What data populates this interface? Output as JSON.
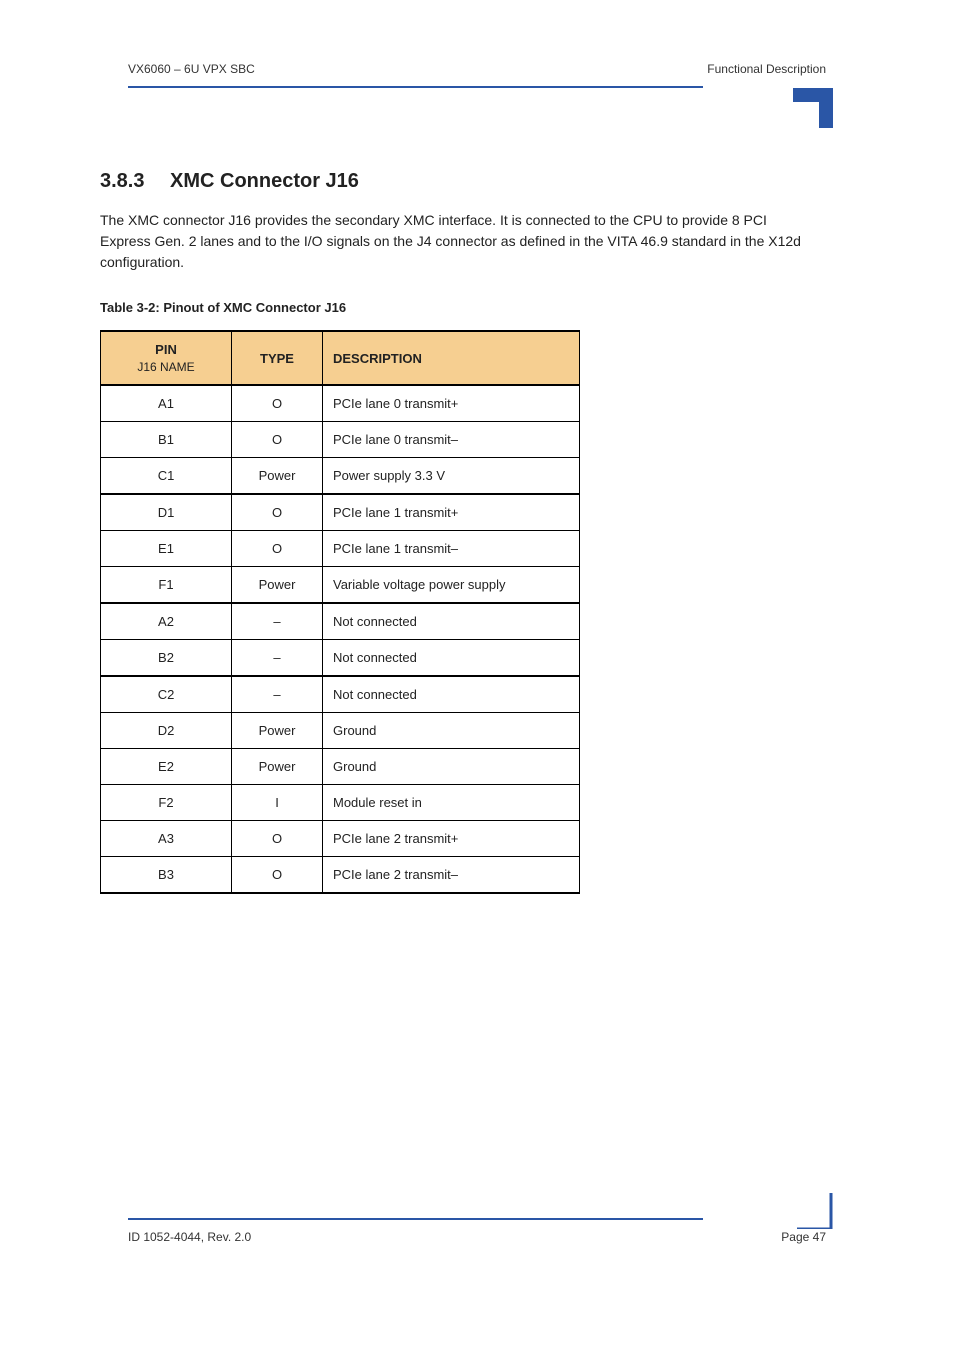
{
  "header": {
    "left": "VX6060 – 6U VPX SBC",
    "right": "Functional Description"
  },
  "section": {
    "number": "3.8.3",
    "title": "XMC Connector J16"
  },
  "paragraph": "The XMC connector J16 provides the secondary XMC interface. It is connected to the CPU to provide 8 PCI Express Gen. 2 lanes and to the I/O signals on the J4 connector as defined in the VITA 46.9 standard in the X12d configuration.",
  "table": {
    "caption": "Table 3-2:  Pinout of XMC Connector J16",
    "columns": [
      {
        "label": "PIN",
        "sub": "J16 NAME"
      },
      {
        "label": "TYPE",
        "sub": ""
      },
      {
        "label": "DESCRIPTION",
        "sub": ""
      }
    ],
    "rows": [
      {
        "pin": "A1",
        "type": "O",
        "desc": "PCIe lane 0 transmit+",
        "group_start": true
      },
      {
        "pin": "B1",
        "type": "O",
        "desc": "PCIe lane 0 transmit–"
      },
      {
        "pin": "C1",
        "type": "Power",
        "desc": "Power supply 3.3 V"
      },
      {
        "pin": "D1",
        "type": "O",
        "desc": "PCIe lane 1 transmit+",
        "group_start": true
      },
      {
        "pin": "E1",
        "type": "O",
        "desc": "PCIe lane 1 transmit–"
      },
      {
        "pin": "F1",
        "type": "Power",
        "desc": "Variable voltage power supply"
      },
      {
        "pin": "A2",
        "type": "–",
        "desc": "Not connected",
        "group_start": true
      },
      {
        "pin": "B2",
        "type": "–",
        "desc": "Not connected"
      },
      {
        "pin": "C2",
        "type": "–",
        "desc": "Not connected",
        "group_start": true
      },
      {
        "pin": "D2",
        "type": "Power",
        "desc": "Ground"
      },
      {
        "pin": "E2",
        "type": "Power",
        "desc": "Ground"
      },
      {
        "pin": "F2",
        "type": "I",
        "desc": "Module reset in"
      },
      {
        "pin": "A3",
        "type": "O",
        "desc": "PCIe lane 2 transmit+"
      },
      {
        "pin": "B3",
        "type": "O",
        "desc": "PCIe lane 2 transmit–"
      }
    ]
  },
  "footer": {
    "left": "ID 1052-4044, Rev. 2.0",
    "right": "Page 47"
  }
}
